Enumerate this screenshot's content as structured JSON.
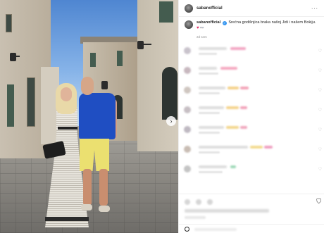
{
  "post": {
    "username": "sabanofficial",
    "caption_username": "sabanofficial",
    "caption_text": "Srećna godišnjica braka našoj Jidi i našem Bokiju.",
    "caption_emoji": "♥",
    "caption_emoji_2": "👓",
    "time_ago": "2d sem",
    "more_icon": "more-horizontal-icon",
    "verified_icon": "verified-badge-icon",
    "next_icon": "chevron-right-icon",
    "bookmark_icon": "bookmark-icon",
    "next_glyph": "›",
    "more_glyph": "···",
    "verified_glyph": "✓",
    "bookmark_glyph": "⛉"
  },
  "comments": [
    {
      "avatar_color": "#c9c3cc",
      "accent_color": "#f2a6c3",
      "accent_color_2": "#e0e0e0"
    },
    {
      "avatar_color": "#c8b8bf",
      "accent_color": "#f5a8c0",
      "accent_color_2": "#e0e0e0"
    },
    {
      "avatar_color": "#cfc6c0",
      "accent_color": "#f4d28a",
      "accent_color_2": "#f3a3b7"
    },
    {
      "avatar_color": "#c7bfc4",
      "accent_color": "#f4d48d",
      "accent_color_2": "#f2a3ba"
    },
    {
      "avatar_color": "#bfb9c2",
      "accent_color": "#f3d68e",
      "accent_color_2": "#f0a7bd"
    },
    {
      "avatar_color": "#c9bdb4",
      "accent_color": "#f3db8f",
      "accent_color_2": "#ef9fc0"
    },
    {
      "avatar_color": "#c4c4c4",
      "accent_color": "#e3e3e3",
      "accent_color_2": "#9fd9b8"
    }
  ],
  "colors": {
    "shirt": "#1f4ec2",
    "shorts": "#ebe070",
    "verified_blue": "#3897f0",
    "heart_red": "#e0245e"
  }
}
